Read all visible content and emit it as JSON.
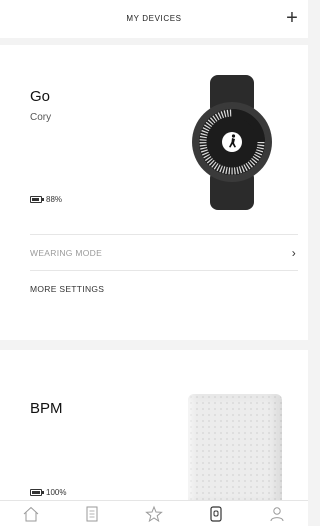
{
  "header": {
    "title": "MY DEVICES",
    "add_icon": "plus-icon"
  },
  "devices": [
    {
      "name": "Go",
      "user": "Cory",
      "battery": "88%",
      "battery_level": 0.88,
      "image": "activity-tracker-watch"
    },
    {
      "name": "BPM",
      "battery": "100%",
      "battery_level": 1.0,
      "image": "blood-pressure-cuff"
    }
  ],
  "go_menu": {
    "wearing_mode": "WEARING MODE",
    "more_settings": "MORE SETTINGS"
  },
  "tabbar": {
    "items": [
      "home-icon",
      "journal-icon",
      "star-icon",
      "devices-icon",
      "profile-icon"
    ],
    "active": "devices-icon"
  }
}
